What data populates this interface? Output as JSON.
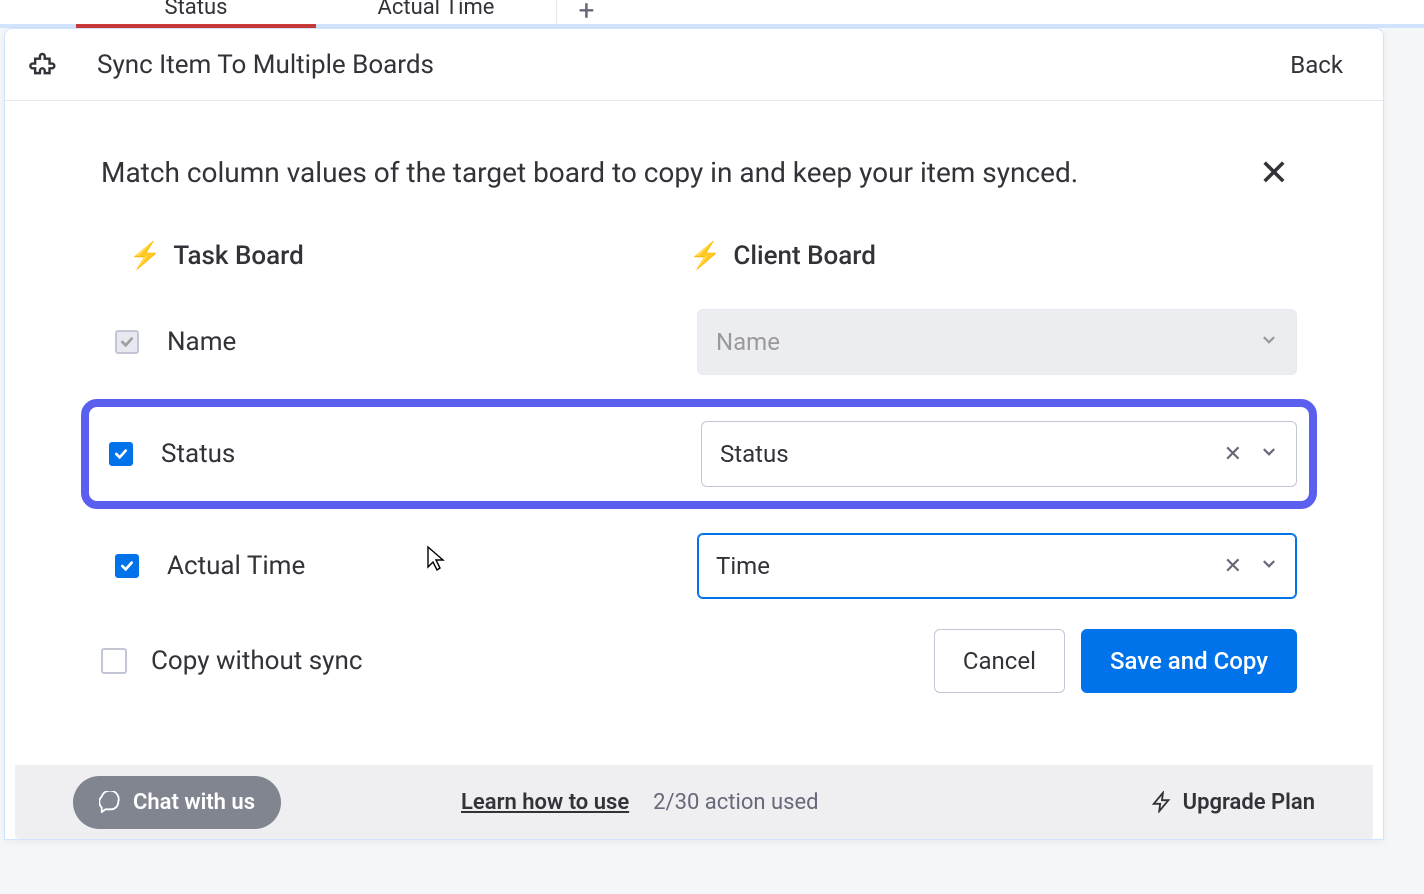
{
  "top_tabs": {
    "status": "Status",
    "actual_time": "Actual Time",
    "plus": "+"
  },
  "header": {
    "title": "Sync Item To Multiple Boards",
    "back": "Back"
  },
  "desc": "Match column values of the target board to copy in and keep your item synced.",
  "boards": {
    "source": "Task Board",
    "target": "Client Board"
  },
  "rows": {
    "name": {
      "src": "Name",
      "sel": "Name"
    },
    "status": {
      "src": "Status",
      "sel": "Status"
    },
    "time": {
      "src": "Actual Time",
      "sel": "Time"
    }
  },
  "copy_without_sync": "Copy without sync",
  "buttons": {
    "cancel": "Cancel",
    "save": "Save and Copy"
  },
  "bottom": {
    "chat": "Chat with us",
    "learn": "Learn how to use",
    "usage": "2/30 action used",
    "upgrade": "Upgrade Plan"
  }
}
